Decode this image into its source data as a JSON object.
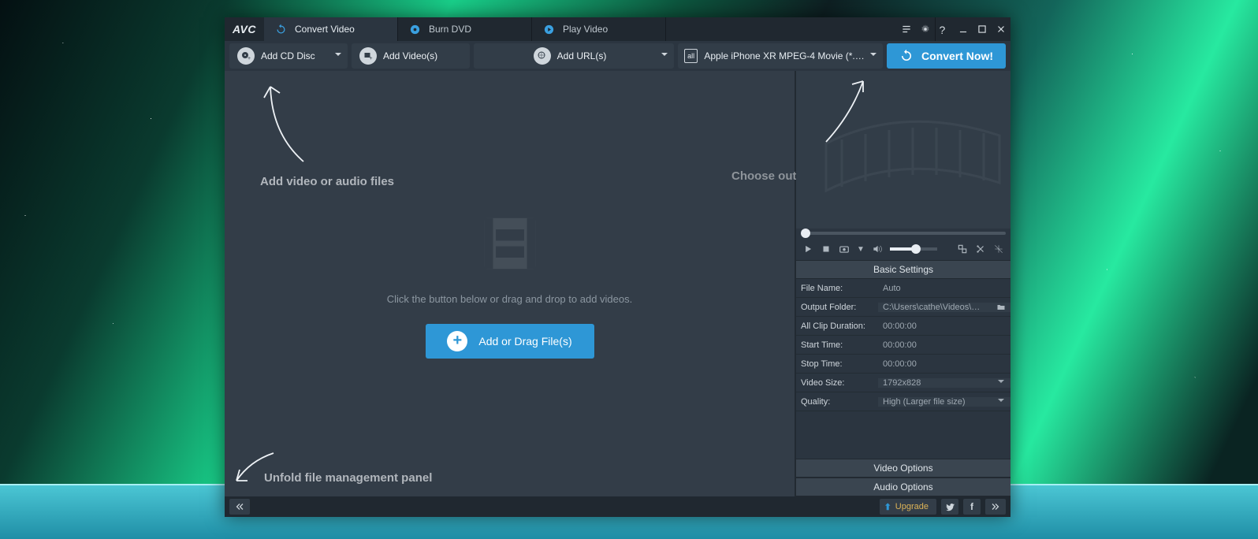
{
  "app": {
    "logo": "AVC"
  },
  "tabs": [
    {
      "label": "Convert Video"
    },
    {
      "label": "Burn DVD"
    },
    {
      "label": "Play Video"
    }
  ],
  "toolbar": {
    "add_cd": "Add CD Disc",
    "add_videos": "Add Video(s)",
    "add_urls": "Add URL(s)",
    "profile": "Apple iPhone XR MPEG-4 Movie (*.m…",
    "convert": "Convert Now!"
  },
  "stage": {
    "hint": "Click the button below or drag and drop to add videos.",
    "add_button": "Add or Drag File(s)"
  },
  "annotations": {
    "add": "Add video or audio files",
    "choose": "Choose output profile and convert",
    "unfold": "Unfold file management panel"
  },
  "settings": {
    "header_basic": "Basic Settings",
    "header_video": "Video Options",
    "header_audio": "Audio Options",
    "rows": {
      "file_name": {
        "k": "File Name:",
        "v": "Auto"
      },
      "output_folder": {
        "k": "Output Folder:",
        "v": "C:\\Users\\cathe\\Videos\\… "
      },
      "all_clip": {
        "k": "All Clip Duration:",
        "v": "00:00:00"
      },
      "start_time": {
        "k": "Start Time:",
        "v": "00:00:00"
      },
      "stop_time": {
        "k": "Stop Time:",
        "v": "00:00:00"
      },
      "video_size": {
        "k": "Video Size:",
        "v": "1792x828"
      },
      "quality": {
        "k": "Quality:",
        "v": "High (Larger file size)"
      }
    }
  },
  "footer": {
    "upgrade": "Upgrade"
  }
}
